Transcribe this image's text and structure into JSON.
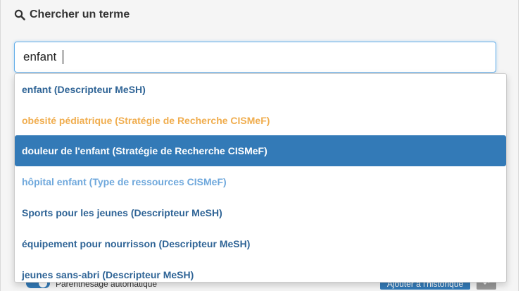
{
  "panel": {
    "title": "Chercher un terme",
    "title_icon": "search-icon"
  },
  "search": {
    "value": "enfant",
    "placeholder": ""
  },
  "suggestions": [
    {
      "label": "enfant (Descripteur MeSH)",
      "color": "#2f6496",
      "selected": false
    },
    {
      "label": "obésité pédiatrique (Stratégie de Recherche CISMeF)",
      "color": "#f0ad4e",
      "selected": false
    },
    {
      "label": "douleur de l'enfant (Stratégie de Recherche CISMeF)",
      "color": "#ffffff",
      "selected": true,
      "background": "#337ab7"
    },
    {
      "label": "hôpital enfant (Type de ressources CISMeF)",
      "color": "#6fa8dc",
      "selected": false
    },
    {
      "label": "Sports pour les jeunes (Descripteur MeSH)",
      "color": "#2f6496",
      "selected": false
    },
    {
      "label": "équipement pour nourrisson (Descripteur MeSH)",
      "color": "#2f6496",
      "selected": false
    },
    {
      "label": "jeunes sans-abri (Descripteur MeSH)",
      "color": "#2f6496",
      "selected": false
    }
  ],
  "options": {
    "toggle_label": "Parenthésage automatique",
    "toggle_on": true,
    "history_button_label": "Ajouter à l'historique",
    "history_icon": "undo-icon"
  },
  "colors": {
    "accent": "#337ab7",
    "focus_border": "#66afe9"
  }
}
